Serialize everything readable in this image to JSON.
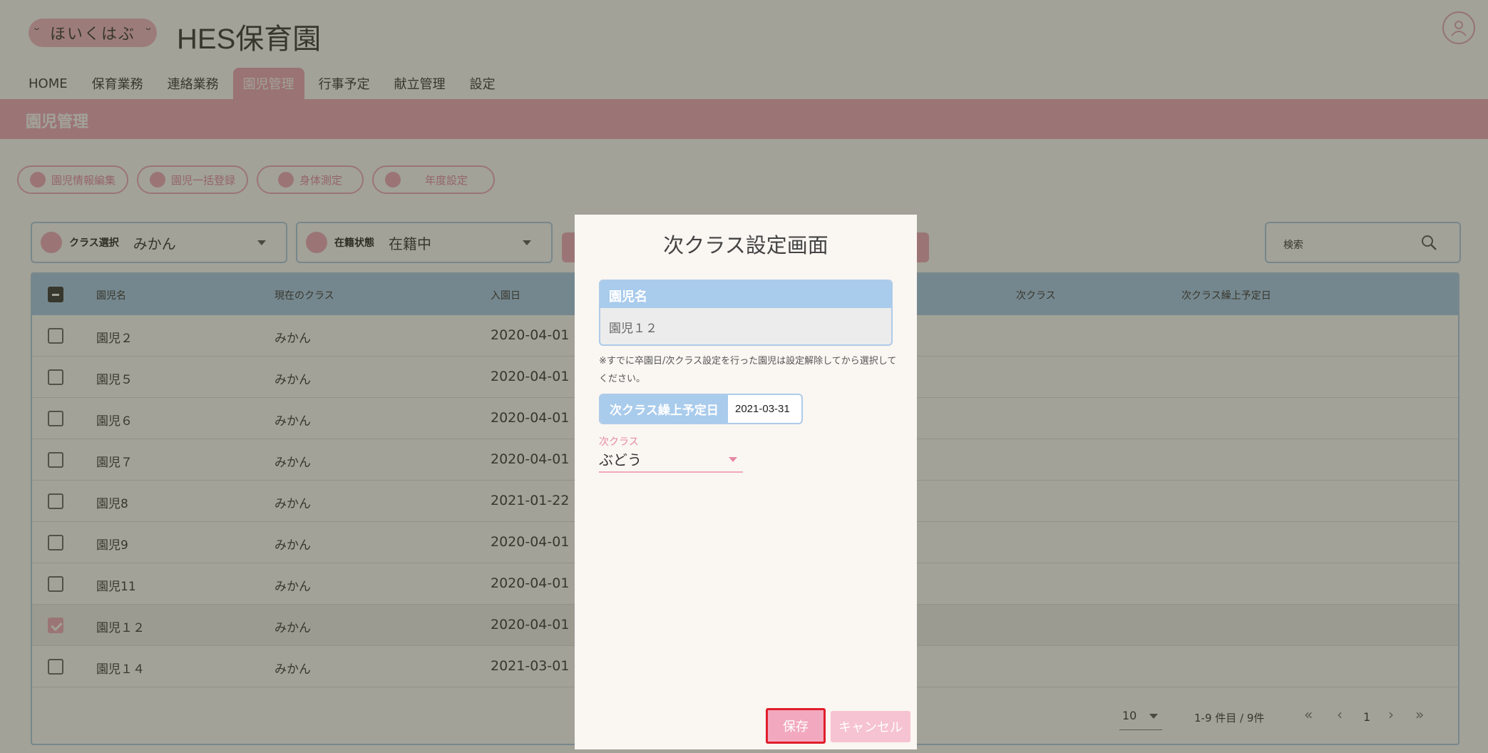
{
  "header": {
    "logo_text": "ほいくはぶ",
    "app_title": "HES保育園",
    "avatar_icon": "user-circle-icon"
  },
  "nav": {
    "tabs": [
      {
        "label": "HOME"
      },
      {
        "label": "保育業務"
      },
      {
        "label": "連絡業務"
      },
      {
        "label": "園児管理",
        "active": true
      },
      {
        "label": "行事予定"
      },
      {
        "label": "献立管理"
      },
      {
        "label": "設定"
      }
    ]
  },
  "banner": {
    "title": "園児管理"
  },
  "actions": [
    {
      "label": "園児情報編集"
    },
    {
      "label": "園児一括登録"
    },
    {
      "label": "身体測定"
    },
    {
      "label": "年度設定"
    }
  ],
  "filters": {
    "class": {
      "label": "クラス選択",
      "value": "みかん"
    },
    "status": {
      "label": "在籍状態",
      "value": "在籍中"
    },
    "search": {
      "placeholder": "検索"
    }
  },
  "table": {
    "headers": {
      "name": "園児名",
      "current_class": "現在のクラス",
      "entry_date": "入園日",
      "next_class": "次クラス",
      "next_class_date": "次クラス繰上予定日"
    },
    "rows": [
      {
        "name": "園児２",
        "class": "みかん",
        "date": "2020-04-01",
        "checked": false
      },
      {
        "name": "園児５",
        "class": "みかん",
        "date": "2020-04-01",
        "checked": false
      },
      {
        "name": "園児６",
        "class": "みかん",
        "date": "2020-04-01",
        "checked": false
      },
      {
        "name": "園児７",
        "class": "みかん",
        "date": "2020-04-01",
        "checked": false
      },
      {
        "name": "園児8",
        "class": "みかん",
        "date": "2021-01-22",
        "checked": false
      },
      {
        "name": "園児9",
        "class": "みかん",
        "date": "2020-04-01",
        "checked": false
      },
      {
        "name": "園児11",
        "class": "みかん",
        "date": "2020-04-01",
        "checked": false
      },
      {
        "name": "園児１２",
        "class": "みかん",
        "date": "2020-04-01",
        "checked": true
      },
      {
        "name": "園児１４",
        "class": "みかん",
        "date": "2021-03-01",
        "checked": false
      }
    ]
  },
  "pagination": {
    "per_page": "10",
    "info": "1-9 件目 / 9件",
    "page": "1"
  },
  "modal": {
    "title": "次クラス設定画面",
    "name_label": "園児名",
    "name_value": "園児１２",
    "note": "※すでに卒園日/次クラス設定を行った園児は設定解除してから選択してください。",
    "date_label": "次クラス繰上予定日",
    "date_value": "2021-03-31",
    "select_label": "次クラス",
    "select_value": "ぶどう",
    "save_label": "保存",
    "cancel_label": "キャンセル"
  }
}
